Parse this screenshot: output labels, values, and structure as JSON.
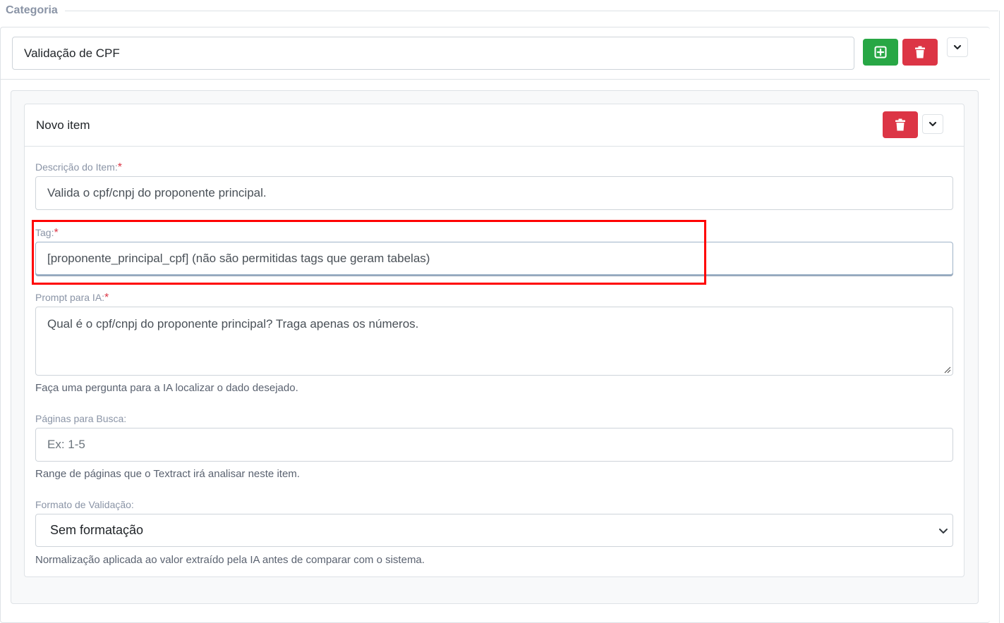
{
  "category": {
    "legend": "Categoria",
    "name_value": "Validação de CPF",
    "add_icon": "plus-square-icon",
    "delete_icon": "trash-icon",
    "toggle_icon": "chevron-down-icon"
  },
  "item": {
    "title": "Novo item",
    "description_label": "Descrição do Item:",
    "description_value": "Valida o cpf/cnpj do proponente principal.",
    "tag_label": "Tag:",
    "tag_value": "[proponente_principal_cpf] (não são permitidas tags que geram tabelas)",
    "prompt_label": "Prompt para IA:",
    "prompt_value": "Qual é o cpf/cnpj do proponente principal? Traga apenas os números.",
    "prompt_help": "Faça uma pergunta para a IA localizar o dado desejado.",
    "pages_label": "Páginas para Busca:",
    "pages_placeholder": "Ex: 1-5",
    "pages_help": "Range de páginas que o Textract irá analisar neste item.",
    "format_label": "Formato de Validação:",
    "format_selected": "Sem formatação",
    "format_help": "Normalização aplicada ao valor extraído pela IA antes de comparar com o sistema.",
    "required_marker": "*"
  },
  "colors": {
    "success": "#28a745",
    "danger": "#dc3545",
    "highlight": "#ff0000"
  }
}
